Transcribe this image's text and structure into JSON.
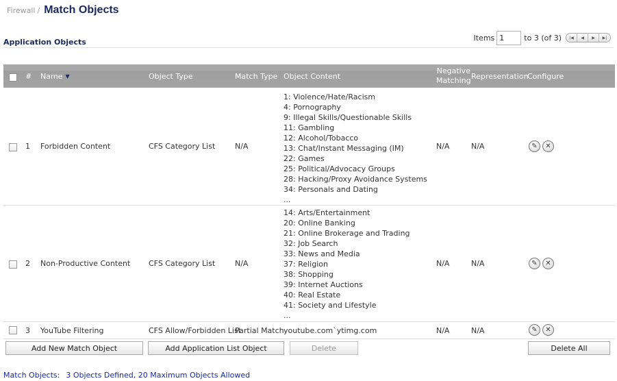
{
  "breadcrumb": {
    "parent": "Firewall",
    "separator": "/",
    "title": "Match Objects"
  },
  "section": {
    "title": "Application Objects"
  },
  "pager": {
    "items_label": "Items",
    "current_item": "1",
    "range_label": "to 3 (of 3)",
    "nav": [
      "first-page-icon",
      "prev-page-icon",
      "next-page-icon",
      "last-page-icon"
    ]
  },
  "table": {
    "headers": {
      "number": "#",
      "name": "Name",
      "object_type": "Object Type",
      "match_type": "Match Type",
      "object_content": "Object Content",
      "negative_matching_1": "Negative",
      "negative_matching_2": "Matching",
      "representation": "Representation",
      "configure": "Configure"
    },
    "rows": [
      {
        "number": "1",
        "name": "Forbidden Content",
        "object_type": "CFS Category List",
        "match_type": "N/A",
        "content": [
          "1: Violence/Hate/Racism",
          "4: Pornography",
          "9: Illegal Skills/Questionable Skills",
          "11: Gambling",
          "12: Alcohol/Tobacco",
          "13: Chat/Instant Messaging (IM)",
          "22: Games",
          "25: Political/Advocacy Groups",
          "28: Hacking/Proxy Avoidance Systems",
          "34: Personals and Dating",
          "..."
        ],
        "negative_matching": "N/A",
        "representation": "N/A"
      },
      {
        "number": "2",
        "name": "Non-Productive Content",
        "object_type": "CFS Category List",
        "match_type": "N/A",
        "content": [
          "14: Arts/Entertainment",
          "20: Online Banking",
          "21: Online Brokerage and Trading",
          "32: Job Search",
          "33: News and Media",
          "37: Religion",
          "38: Shopping",
          "39: Internet Auctions",
          "40: Real Estate",
          "41: Society and Lifestyle",
          "..."
        ],
        "negative_matching": "N/A",
        "representation": "N/A"
      },
      {
        "number": "3",
        "name": "YouTube Filtering",
        "object_type": "CFS Allow/Forbidden List",
        "match_type": "Partial Match",
        "content": [
          "youtube.com`ytimg.com"
        ],
        "negative_matching": "N/A",
        "representation": "N/A"
      }
    ],
    "configure_icons": [
      "edit-pencil-icon",
      "delete-x-icon"
    ]
  },
  "actions": {
    "add_match_object": "Add New Match Object",
    "add_app_list_object": "Add Application List Object",
    "delete": "Delete",
    "delete_all": "Delete All"
  },
  "footer": {
    "label": "Match Objects:",
    "value": "3 Objects Defined, 20 Maximum Objects Allowed"
  },
  "colors": {
    "title": "#1a2a5c",
    "header_bg": "#a4a4a4",
    "footer_text": "#1a2aa0",
    "sort_arrow": "#1a2a6e"
  }
}
